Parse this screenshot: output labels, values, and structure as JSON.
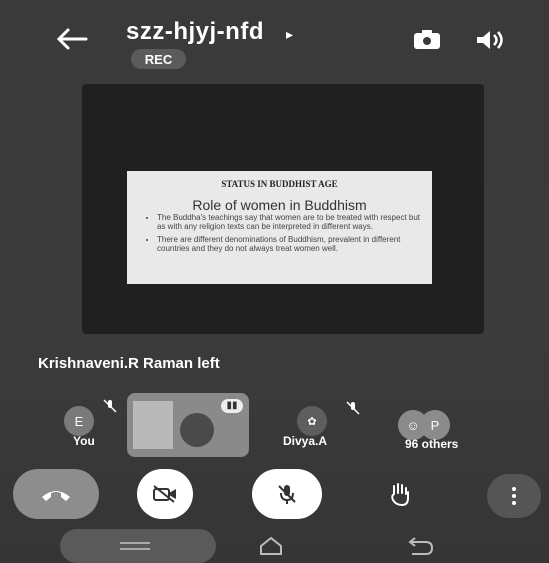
{
  "header": {
    "meeting_code": "szz-hjyj-nfd",
    "chevron": "▸",
    "rec_label": "REC",
    "icons": [
      "back-arrow-icon",
      "switch-camera-icon",
      "speaker-icon"
    ]
  },
  "slide": {
    "heading": "STATUS IN BUDDHIST AGE",
    "title": "Role of women in Buddhism",
    "bullets": [
      "The Buddha's teachings say that women are to be treated with respect but as with any religion texts can be interpreted in different ways.",
      "There are different denominations of Buddhism, prevalent in different countries and they do not always treat women well."
    ]
  },
  "notice": "Krishnaveni.R Raman left",
  "participants": {
    "you_initial": "E",
    "you_label": "You",
    "divya_label": "Divya.A",
    "others_initial": "P",
    "others_label": "96 others"
  },
  "controls": [
    "end-call",
    "camera-off",
    "mic-off",
    "raise-hand",
    "more-options"
  ],
  "colors": {
    "accent": "#ffffff",
    "background": "#3a3a3a"
  }
}
